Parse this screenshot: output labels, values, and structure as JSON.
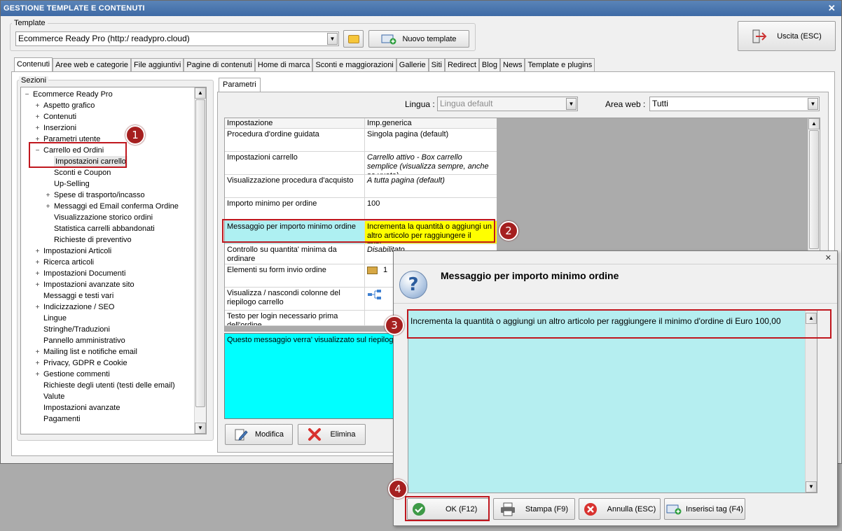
{
  "window": {
    "title": "GESTIONE TEMPLATE E CONTENUTI",
    "close_glyph": "✕"
  },
  "template": {
    "group_label": "Template",
    "selected": "Ecommerce Ready Pro (http:/        readypro.cloud)",
    "new_button": "Nuovo template"
  },
  "exit_button": "Uscita (ESC)",
  "tabs": [
    "Contenuti",
    "Aree web e categorie",
    "File aggiuntivi",
    "Pagine di contenuti",
    "Home di marca",
    "Sconti e maggiorazioni",
    "Gallerie",
    "Siti",
    "Redirect",
    "Blog",
    "News",
    "Template e plugins"
  ],
  "sections": {
    "group_label": "Sezioni",
    "tree": [
      {
        "label": "Ecommerce Ready Pro",
        "level": 0,
        "expander": "−"
      },
      {
        "label": "Aspetto grafico",
        "level": 1,
        "expander": "+"
      },
      {
        "label": "Contenuti",
        "level": 1,
        "expander": "+"
      },
      {
        "label": "Inserzioni",
        "level": 1,
        "expander": "+"
      },
      {
        "label": "Parametri utente",
        "level": 1,
        "expander": "+"
      },
      {
        "label": "Carrello ed Ordini",
        "level": 1,
        "expander": "−"
      },
      {
        "label": "Impostazioni carrello",
        "level": 2,
        "expander": "",
        "selected": true
      },
      {
        "label": "Sconti e Coupon",
        "level": 2,
        "expander": ""
      },
      {
        "label": "Up-Selling",
        "level": 2,
        "expander": ""
      },
      {
        "label": "Spese di trasporto/incasso",
        "level": 2,
        "expander": "+"
      },
      {
        "label": "Messaggi ed Email conferma Ordine",
        "level": 2,
        "expander": "+"
      },
      {
        "label": "Visualizzazione storico ordini",
        "level": 2,
        "expander": ""
      },
      {
        "label": "Statistica carrelli abbandonati",
        "level": 2,
        "expander": ""
      },
      {
        "label": "Richieste di preventivo",
        "level": 2,
        "expander": ""
      },
      {
        "label": "Impostazioni Articoli",
        "level": 1,
        "expander": "+"
      },
      {
        "label": "Ricerca articoli",
        "level": 1,
        "expander": "+"
      },
      {
        "label": "Impostazioni Documenti",
        "level": 1,
        "expander": "+"
      },
      {
        "label": "Impostazioni avanzate sito",
        "level": 1,
        "expander": "+"
      },
      {
        "label": "Messaggi e testi vari",
        "level": 1,
        "expander": ""
      },
      {
        "label": "Indicizzazione / SEO",
        "level": 1,
        "expander": "+"
      },
      {
        "label": "Lingue",
        "level": 1,
        "expander": ""
      },
      {
        "label": "Stringhe/Traduzioni",
        "level": 1,
        "expander": ""
      },
      {
        "label": "Pannello amministrativo",
        "level": 1,
        "expander": ""
      },
      {
        "label": "Mailing list e notifiche email",
        "level": 1,
        "expander": "+"
      },
      {
        "label": "Privacy, GDPR e Cookie",
        "level": 1,
        "expander": "+"
      },
      {
        "label": "Gestione commenti",
        "level": 1,
        "expander": "+"
      },
      {
        "label": "Richieste degli utenti (testi delle email)",
        "level": 1,
        "expander": ""
      },
      {
        "label": "Valute",
        "level": 1,
        "expander": ""
      },
      {
        "label": "Impostazioni avanzate",
        "level": 1,
        "expander": ""
      },
      {
        "label": "Pagamenti",
        "level": 1,
        "expander": ""
      }
    ]
  },
  "params": {
    "tab": "Parametri",
    "lingua_label": "Lingua :",
    "lingua_value": "Lingua default",
    "area_label": "Area web :",
    "area_value": "Tutti",
    "header": {
      "col1": "Impostazione",
      "col2": "Imp.generica"
    },
    "rows": [
      {
        "name": "Procedura d'ordine guidata",
        "value": "Singola pagina (default)",
        "italic": false
      },
      {
        "name": "Impostazioni carrello",
        "value": "Carrello attivo - Box carrello semplice (visualizza sempre, anche se vuoto)",
        "italic": true
      },
      {
        "name": "Visualizzazione procedura d'acquisto",
        "value": "A tutta pagina (default)",
        "italic": true
      },
      {
        "name": "Importo minimo per ordine",
        "value": "100",
        "italic": false
      },
      {
        "name": "Messaggio per importo minimo ordine",
        "value": "Incrementa la quantità o aggiungi un altro articolo per raggiungere il mini…",
        "italic": false,
        "highlight": true
      },
      {
        "name": "Controllo su quantita' minima da ordinare",
        "value": "Disabilitato",
        "italic": true
      },
      {
        "name": "Elementi su form invio ordine",
        "value": "1",
        "italic": false,
        "icon": true
      },
      {
        "name": "Visualizza / nascondi colonne del riepilogo carrello",
        "value": "",
        "italic": false,
        "icon2": true
      },
      {
        "name": "Testo per login necessario prima dell'ordine",
        "value": "",
        "italic": false
      }
    ],
    "description": "Questo messaggio verra' visualizzato sul riepilogo c",
    "edit_button": "Modifica",
    "delete_button": "Elimina"
  },
  "dialog": {
    "title": "Messaggio per importo minimo ordine",
    "text": "Incrementa la quantità o aggiungi un altro articolo per raggiungere il minimo d'ordine di Euro 100,00",
    "ok": "OK (F12)",
    "print": "Stampa (F9)",
    "cancel": "Annulla (ESC)",
    "insert_tag": "Inserisci tag (F4)"
  },
  "badges": [
    "1",
    "2",
    "3",
    "4"
  ],
  "colors": {
    "accent_red": "#c0171e",
    "highlight_yellow": "#ffff00",
    "selected_cyan": "#aef0f2",
    "dialog_text_bg": "#b5eef0"
  }
}
